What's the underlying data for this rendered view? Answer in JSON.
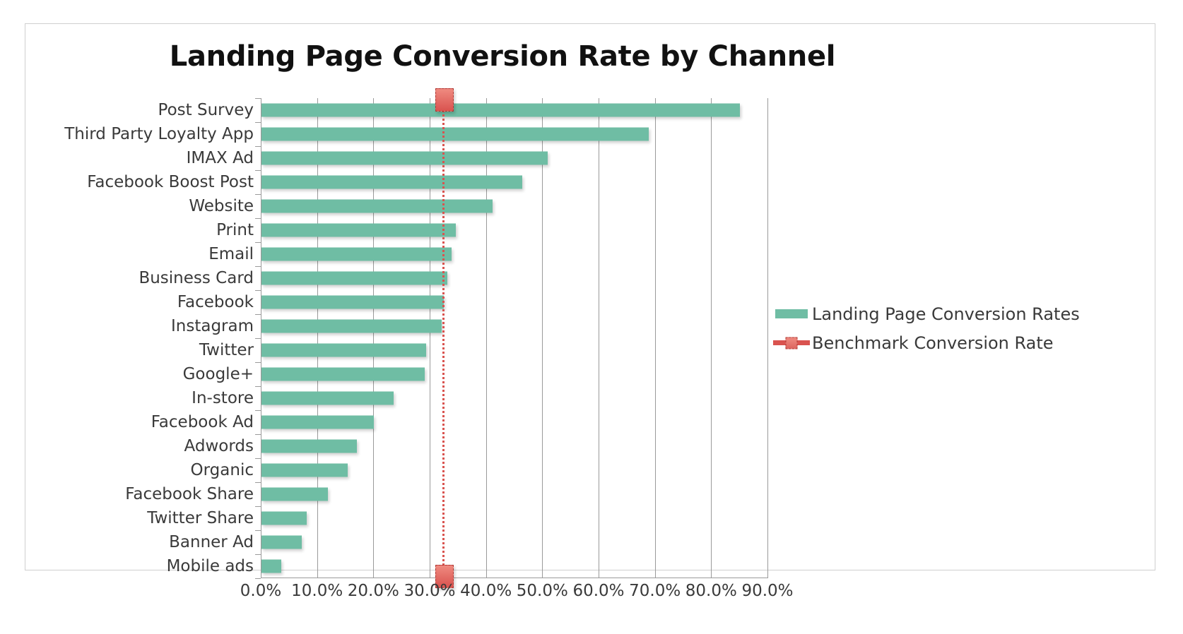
{
  "chart": {
    "title": "Landing Page Conversion Rate by Channel",
    "colors": {
      "bar": "#6fbda4",
      "benchmark": "#d9534f",
      "grid": "#9a9a9a",
      "text": "#3a3a3a",
      "frame": "#cfcfcf",
      "background": "#ffffff"
    }
  },
  "legend": {
    "position": "right",
    "items": [
      {
        "label": "Landing Page Conversion Rates",
        "type": "bar",
        "color": "#6fbda4"
      },
      {
        "label": "Benchmark Conversion Rate",
        "type": "line-marker",
        "color": "#d9534f"
      }
    ]
  },
  "chart_data": {
    "type": "bar",
    "orientation": "horizontal",
    "title": "Landing Page Conversion Rate by Channel",
    "xlabel": "",
    "ylabel": "",
    "xlim": [
      0,
      90
    ],
    "grid": true,
    "xticks": [
      0,
      10,
      20,
      30,
      40,
      50,
      60,
      70,
      80,
      90
    ],
    "xtick_labels": [
      "0.0%",
      "10.0%",
      "20.0%",
      "30.0%",
      "40.0%",
      "50.0%",
      "60.0%",
      "70.0%",
      "80.0%",
      "90.0%"
    ],
    "categories": [
      "Post Survey",
      "Third Party Loyalty App",
      "IMAX Ad",
      "Facebook Boost Post",
      "Website",
      "Print",
      "Email",
      "Business Card",
      "Facebook",
      "Instagram",
      "Twitter",
      "Google+",
      "In-store",
      "Facebook Ad",
      "Adwords",
      "Organic",
      "Facebook Share",
      "Twitter Share",
      "Banner Ad",
      "Mobile ads"
    ],
    "series": [
      {
        "name": "Landing Page Conversion Rates",
        "color": "#6fbda4",
        "values": [
          85.0,
          68.8,
          50.8,
          46.3,
          41.0,
          34.5,
          33.8,
          33.0,
          32.4,
          32.0,
          29.3,
          29.0,
          23.5,
          20.0,
          17.0,
          15.3,
          11.8,
          8.0,
          7.2,
          3.5
        ]
      },
      {
        "name": "Benchmark Conversion Rate",
        "color": "#d9534f",
        "type": "reference-line",
        "value": 32.2
      }
    ]
  }
}
